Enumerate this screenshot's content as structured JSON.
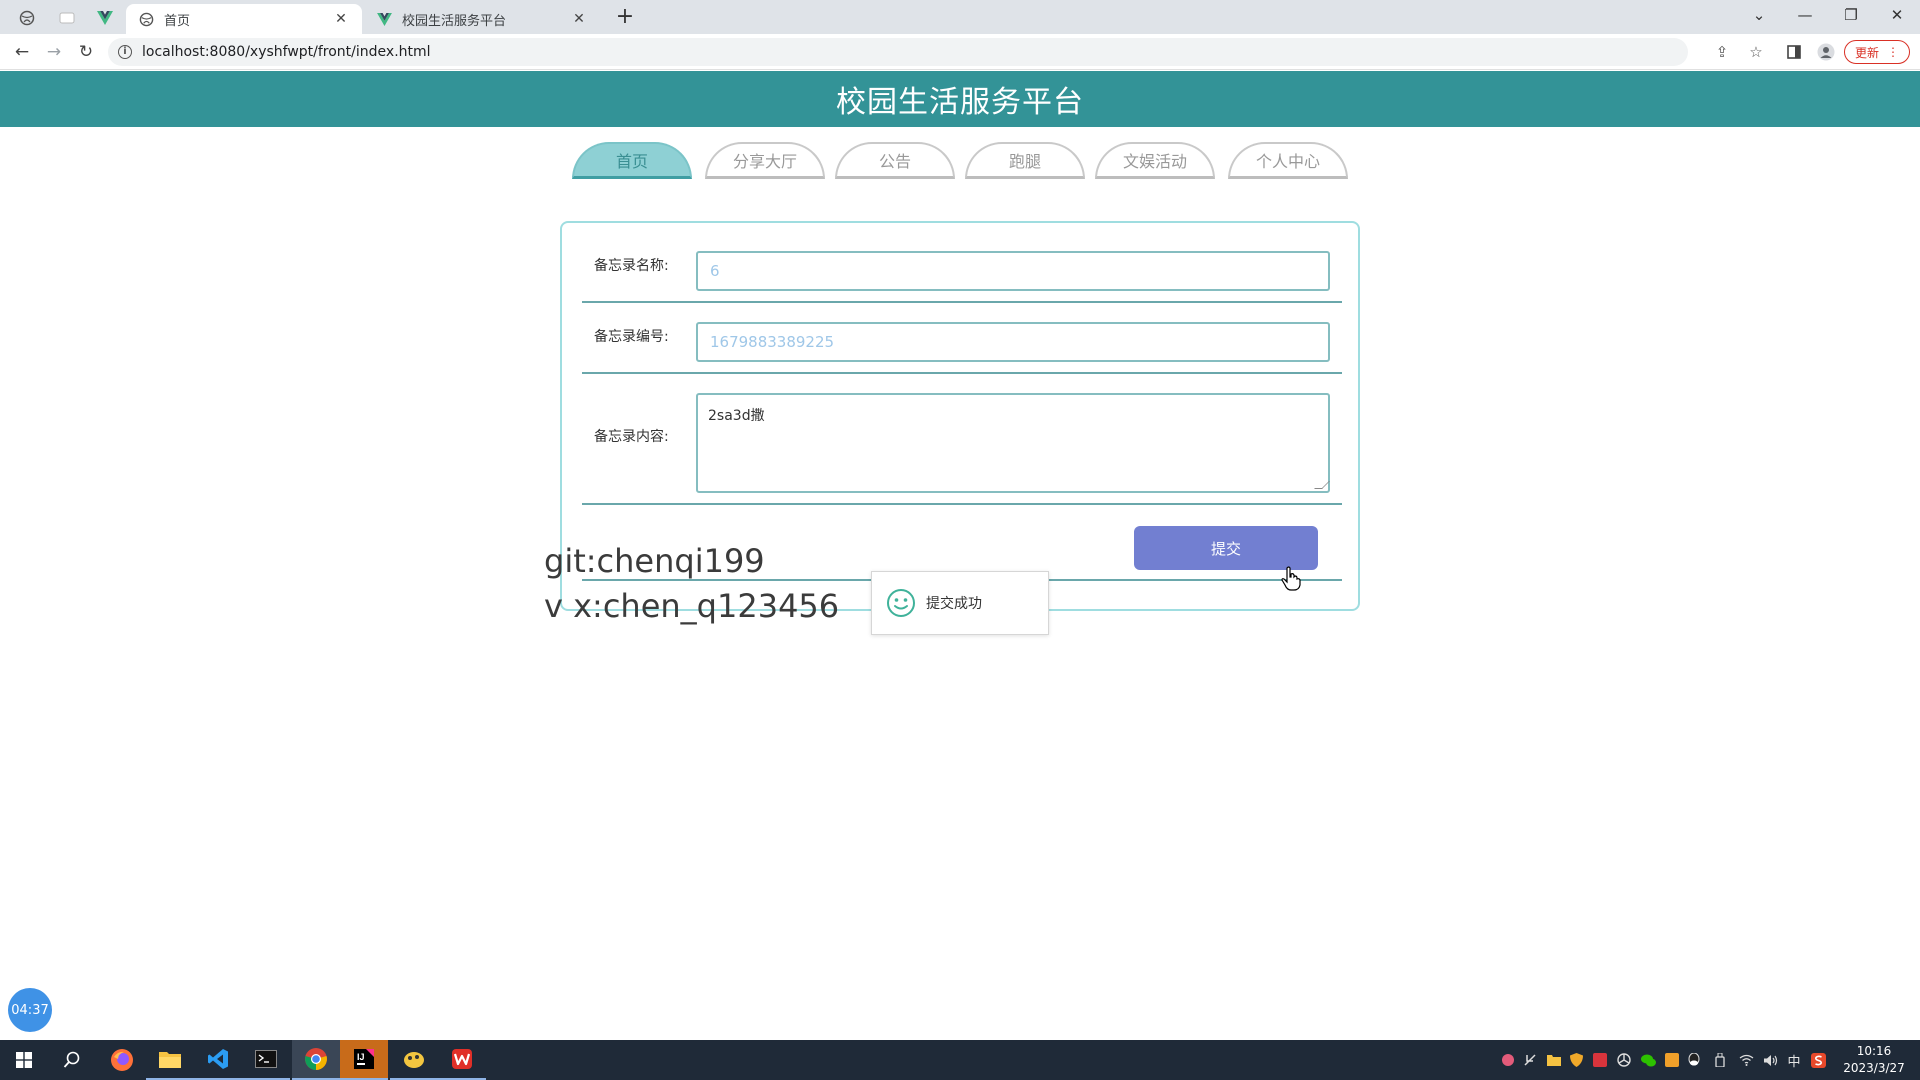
{
  "browser": {
    "tabs": [
      {
        "title": "首页",
        "active": true,
        "favicon": "globe-icon"
      },
      {
        "title": "校园生活服务平台",
        "active": false,
        "favicon": "vue-logo-icon"
      }
    ],
    "url": "localhost:8080/xyshfwpt/front/index.html",
    "update_label": "更新"
  },
  "header": {
    "title": "校园生活服务平台"
  },
  "nav": {
    "items": [
      {
        "label": "首页",
        "active": true
      },
      {
        "label": "分享大厅",
        "active": false
      },
      {
        "label": "公告",
        "active": false
      },
      {
        "label": "跑腿",
        "active": false
      },
      {
        "label": "文娱活动",
        "active": false
      },
      {
        "label": "个人中心",
        "active": false
      }
    ]
  },
  "form": {
    "name_label": "备忘录名称:",
    "name_value": "6",
    "number_label": "备忘录编号:",
    "number_value": "1679883389225",
    "content_label": "备忘录内容:",
    "content_value": "2sa3d撒",
    "submit_label": "提交"
  },
  "toast": {
    "message": "提交成功"
  },
  "watermark": {
    "line1": "git:chenqi199",
    "line2": "v x:chen_q123456"
  },
  "timer": {
    "value": "04:37"
  },
  "taskbar": {
    "time": "10:16",
    "date": "2023/3/27",
    "ime": "中"
  },
  "colors": {
    "header_bg": "#339397",
    "nav_active_bg": "#8ed0d4",
    "submit_bg": "#727fd1",
    "card_border": "#9fdde0"
  }
}
